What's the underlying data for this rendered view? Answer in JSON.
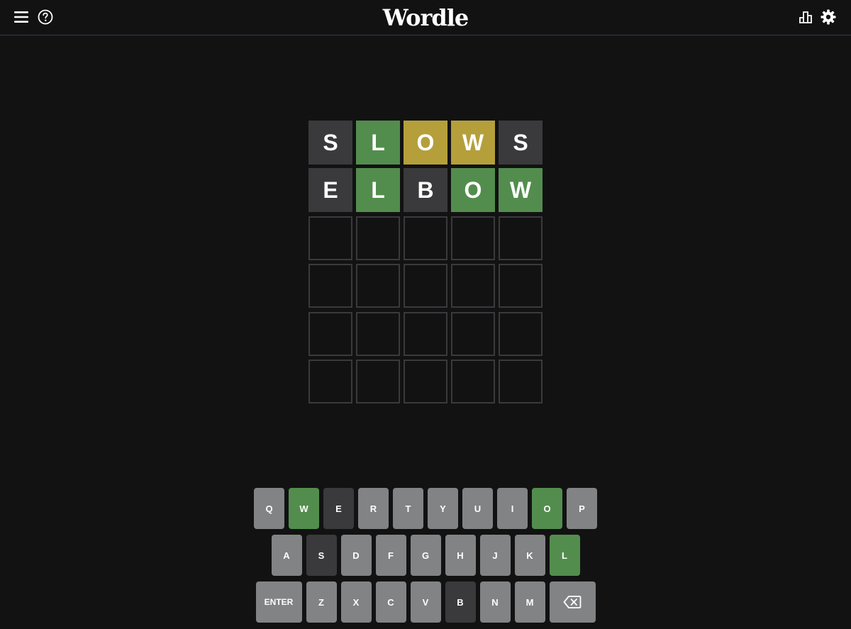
{
  "header": {
    "title": "Wordle",
    "icons": {
      "menu": "hamburger-menu-icon",
      "help": "help-circle-icon",
      "stats": "bar-chart-icon",
      "settings": "gear-icon"
    }
  },
  "colors": {
    "background": "#121213",
    "absent": "#3a3a3c",
    "present": "#b59f3b",
    "correct": "#538d4e",
    "key_default": "#818384",
    "empty_border": "#3a3a3c"
  },
  "board": {
    "rows": [
      {
        "tiles": [
          {
            "letter": "S",
            "state": "absent"
          },
          {
            "letter": "L",
            "state": "correct"
          },
          {
            "letter": "O",
            "state": "present"
          },
          {
            "letter": "W",
            "state": "present"
          },
          {
            "letter": "S",
            "state": "absent"
          }
        ]
      },
      {
        "tiles": [
          {
            "letter": "E",
            "state": "absent"
          },
          {
            "letter": "L",
            "state": "correct"
          },
          {
            "letter": "B",
            "state": "absent"
          },
          {
            "letter": "O",
            "state": "correct"
          },
          {
            "letter": "W",
            "state": "correct"
          }
        ]
      },
      {
        "tiles": [
          {
            "letter": "",
            "state": "empty"
          },
          {
            "letter": "",
            "state": "empty"
          },
          {
            "letter": "",
            "state": "empty"
          },
          {
            "letter": "",
            "state": "empty"
          },
          {
            "letter": "",
            "state": "empty"
          }
        ]
      },
      {
        "tiles": [
          {
            "letter": "",
            "state": "empty"
          },
          {
            "letter": "",
            "state": "empty"
          },
          {
            "letter": "",
            "state": "empty"
          },
          {
            "letter": "",
            "state": "empty"
          },
          {
            "letter": "",
            "state": "empty"
          }
        ]
      },
      {
        "tiles": [
          {
            "letter": "",
            "state": "empty"
          },
          {
            "letter": "",
            "state": "empty"
          },
          {
            "letter": "",
            "state": "empty"
          },
          {
            "letter": "",
            "state": "empty"
          },
          {
            "letter": "",
            "state": "empty"
          }
        ]
      },
      {
        "tiles": [
          {
            "letter": "",
            "state": "empty"
          },
          {
            "letter": "",
            "state": "empty"
          },
          {
            "letter": "",
            "state": "empty"
          },
          {
            "letter": "",
            "state": "empty"
          },
          {
            "letter": "",
            "state": "empty"
          }
        ]
      }
    ]
  },
  "keyboard": {
    "rows": [
      {
        "keys": [
          {
            "label": "Q",
            "state": "default"
          },
          {
            "label": "W",
            "state": "correct"
          },
          {
            "label": "E",
            "state": "absent"
          },
          {
            "label": "R",
            "state": "default"
          },
          {
            "label": "T",
            "state": "default"
          },
          {
            "label": "Y",
            "state": "default"
          },
          {
            "label": "U",
            "state": "default"
          },
          {
            "label": "I",
            "state": "default"
          },
          {
            "label": "O",
            "state": "correct"
          },
          {
            "label": "P",
            "state": "default"
          }
        ]
      },
      {
        "keys": [
          {
            "label": "A",
            "state": "default"
          },
          {
            "label": "S",
            "state": "absent"
          },
          {
            "label": "D",
            "state": "default"
          },
          {
            "label": "F",
            "state": "default"
          },
          {
            "label": "G",
            "state": "default"
          },
          {
            "label": "H",
            "state": "default"
          },
          {
            "label": "J",
            "state": "default"
          },
          {
            "label": "K",
            "state": "default"
          },
          {
            "label": "L",
            "state": "correct"
          }
        ]
      },
      {
        "keys": [
          {
            "label": "ENTER",
            "state": "default",
            "wide": true
          },
          {
            "label": "Z",
            "state": "default"
          },
          {
            "label": "X",
            "state": "default"
          },
          {
            "label": "C",
            "state": "default"
          },
          {
            "label": "V",
            "state": "default"
          },
          {
            "label": "B",
            "state": "absent"
          },
          {
            "label": "N",
            "state": "default"
          },
          {
            "label": "M",
            "state": "default"
          },
          {
            "label": "",
            "state": "default",
            "wide": true,
            "icon": "backspace-icon"
          }
        ]
      }
    ]
  }
}
